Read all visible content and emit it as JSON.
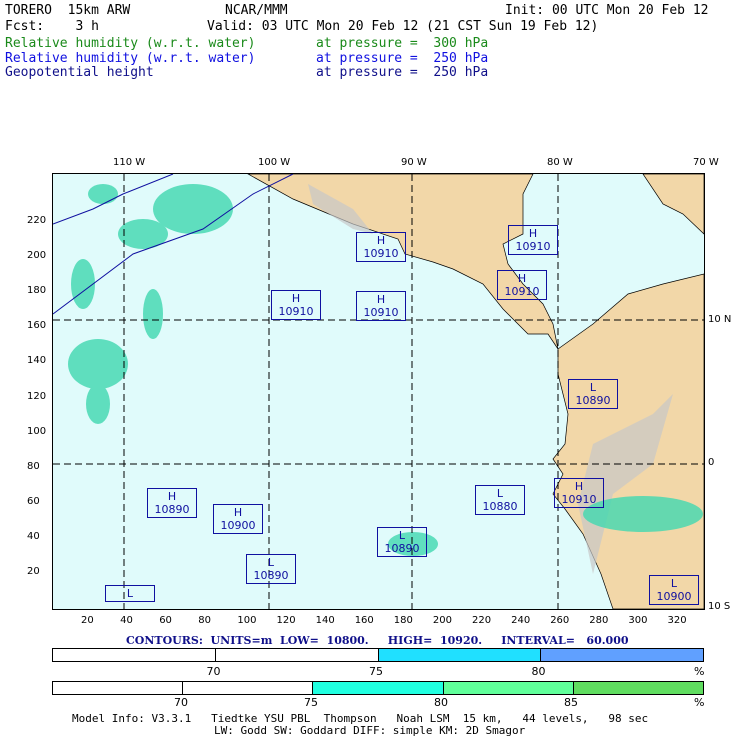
{
  "header": {
    "model": "TORERO  15km ARW",
    "org": "NCAR/MMM",
    "init": "Init: 00 UTC Mon 20 Feb 12",
    "fcst": "Fcst:    3 h",
    "valid": "Valid: 03 UTC Mon 20 Feb 12 (21 CST Sun 19 Feb 12)"
  },
  "fields": [
    {
      "name": "Relative humidity (w.r.t. water)",
      "level": "at pressure =  300 hPa",
      "color": "#1a8a1a"
    },
    {
      "name": "Relative humidity (w.r.t. water)",
      "level": "at pressure =  250 hPa",
      "color": "#1010e0"
    },
    {
      "name": "Geopotential height",
      "level": "at pressure =  250 hPa",
      "color": "#10108a"
    }
  ],
  "axes": {
    "top": [
      "110 W",
      "100 W",
      "90 W",
      "80 W",
      "70 W"
    ],
    "right": [
      "10 N",
      "0",
      "10 S"
    ],
    "left": [
      "20",
      "40",
      "60",
      "80",
      "100",
      "120",
      "140",
      "160",
      "180",
      "200",
      "220"
    ],
    "bottom": [
      "20",
      "40",
      "60",
      "80",
      "100",
      "120",
      "140",
      "160",
      "180",
      "200",
      "220",
      "240",
      "260",
      "280",
      "300",
      "320"
    ]
  },
  "markers": [
    {
      "type": "H",
      "value": "10910"
    },
    {
      "type": "H",
      "value": "10910"
    },
    {
      "type": "H",
      "value": "10910"
    },
    {
      "type": "H",
      "value": "10910"
    },
    {
      "type": "H",
      "value": "10910"
    },
    {
      "type": "H",
      "value": "10910"
    },
    {
      "type": "L",
      "value": "10890"
    },
    {
      "type": "H",
      "value": "10890"
    },
    {
      "type": "H",
      "value": "10900"
    },
    {
      "type": "L",
      "value": "10890"
    },
    {
      "type": "L",
      "value": "10890"
    },
    {
      "type": "L",
      "value": "10880"
    },
    {
      "type": "L",
      "value": "10900"
    },
    {
      "type": "L",
      "value": ""
    }
  ],
  "contours": "CONTOURS:  UNITS=m  LOW=  10800.     HIGH=  10920.     INTERVAL=   60.000",
  "colorbar1": {
    "labels": [
      "70",
      "75",
      "80",
      "%"
    ],
    "colors": [
      "#ffffff",
      "#ffffff",
      "#20e0ff",
      "#60a0ff"
    ]
  },
  "colorbar2": {
    "labels": [
      "70",
      "75",
      "80",
      "85",
      "%"
    ],
    "colors": [
      "#ffffff",
      "#ffffff",
      "#20ffe0",
      "#60ff9a",
      "#60dd60"
    ]
  },
  "footer": {
    "line1": "Model Info: V3.3.1   Tiedtke YSU PBL  Thompson   Noah LSM  15 km,   44 levels,   98 sec",
    "line2": "LW: Godd SW: Goddard DIFF: simple KM: 2D Smagor"
  }
}
